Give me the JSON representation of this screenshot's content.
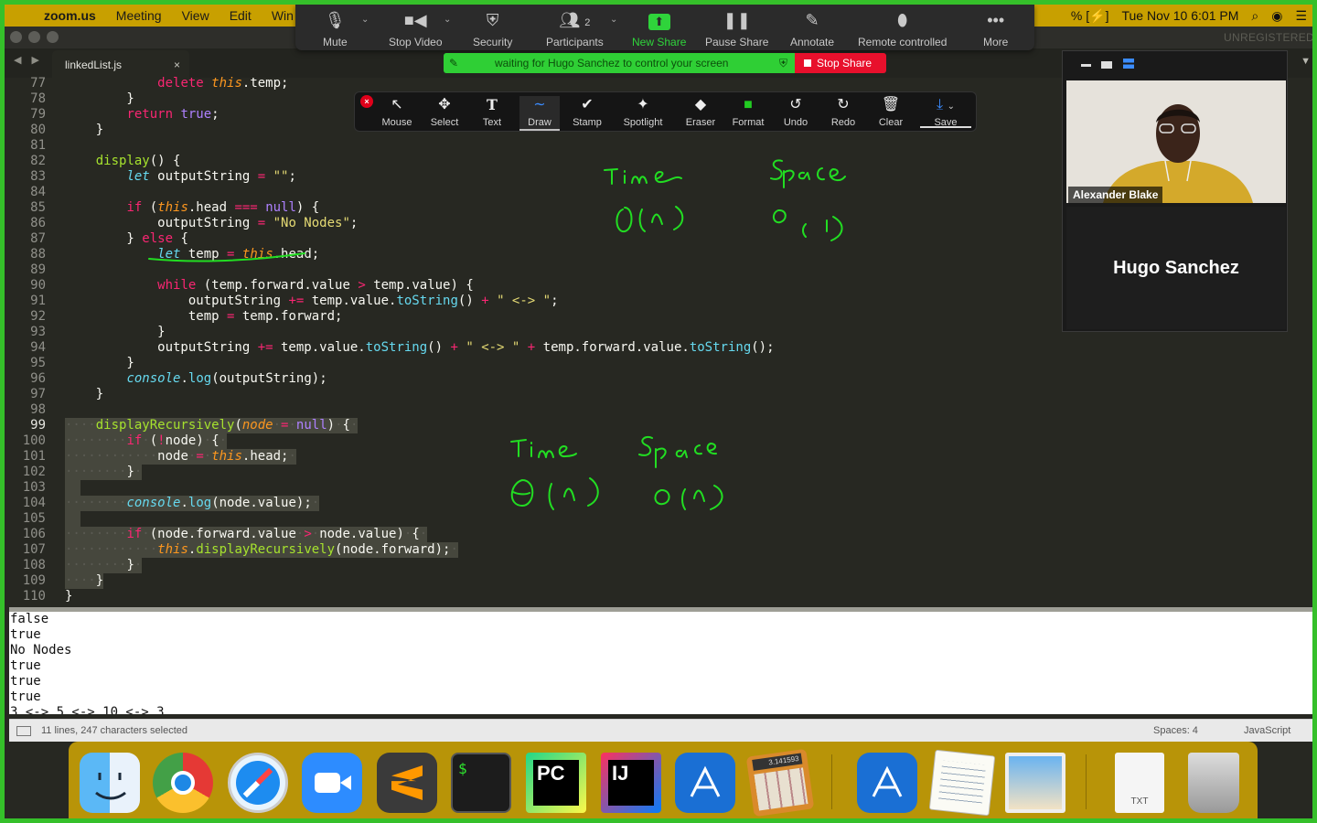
{
  "menubar": {
    "apple": "",
    "app": "zoom.us",
    "items": [
      "Meeting",
      "View",
      "Edit",
      "Win"
    ],
    "right": {
      "battery": "% [⚡]",
      "datetime": "Tue Nov 10  6:01 PM"
    }
  },
  "editor_window": {
    "watermark": "UNREGISTERED",
    "tab_label": "linkedList.js",
    "tab_close": "×",
    "nav_arrows": "◀ ▶",
    "tab_dropdown": "▼"
  },
  "zoom_toolbar": {
    "mute": "Mute",
    "stop_video": "Stop Video",
    "security": "Security",
    "participants": "Participants",
    "participants_count": "2",
    "new_share": "New Share",
    "pause_share": "Pause Share",
    "annotate": "Annotate",
    "remote_controlled": "Remote controlled",
    "more": "More",
    "caret": "⌄"
  },
  "share_notice": {
    "message": "waiting for Hugo Sanchez to control your screen",
    "stop_share": "Stop Share"
  },
  "annotation_toolbar": {
    "close": "×",
    "tools": [
      {
        "label": "Mouse",
        "icon": "↖"
      },
      {
        "label": "Select",
        "icon": "✥"
      },
      {
        "label": "Text",
        "icon": "T"
      },
      {
        "label": "Draw",
        "icon": "∼"
      },
      {
        "label": "Stamp",
        "icon": "✔"
      },
      {
        "label": "Spotlight",
        "icon": "✦"
      },
      {
        "label": "Eraser",
        "icon": "◆"
      },
      {
        "label": "Format",
        "icon": "■"
      },
      {
        "label": "Undo",
        "icon": "↺"
      },
      {
        "label": "Redo",
        "icon": "↻"
      },
      {
        "label": "Clear",
        "icon": "🗑"
      }
    ],
    "save": "Save",
    "save_icon": "⤓",
    "save_caret": "⌄",
    "format_color": "#22cc22"
  },
  "code": {
    "line_numbers": [
      "77",
      "78",
      "79",
      "80",
      "81",
      "82",
      "83",
      "84",
      "85",
      "86",
      "87",
      "88",
      "89",
      "90",
      "91",
      "92",
      "93",
      "94",
      "95",
      "96",
      "97",
      "98",
      "99",
      "100",
      "101",
      "102",
      "103",
      "104",
      "105",
      "106",
      "107",
      "108",
      "109",
      "110"
    ],
    "current_line": "99"
  },
  "drawing_color": "#22dd22",
  "console": {
    "lines": [
      "false",
      "true",
      "No Nodes",
      "true",
      "true",
      "true",
      "3 <-> 5 <-> 10 <-> 3"
    ]
  },
  "status_bar": {
    "selection": "11 lines, 247 characters selected",
    "indent": "Spaces: 4",
    "syntax": "JavaScript"
  },
  "participants": {
    "self_name": "Alexander Blake",
    "remote_name": "Hugo Sanchez"
  },
  "dock": {
    "apps": [
      "Finder",
      "Chrome",
      "Safari",
      "Zoom",
      "Sublime Text",
      "Terminal",
      "PyCharm",
      "IntelliJ IDEA",
      "Xcode",
      "Calculator",
      "Xcode",
      "TextEdit",
      "Preview",
      "TXT",
      "Trash"
    ],
    "terminal_prompt": "$",
    "pycharm_badge": "PC",
    "intellij_badge": "IJ",
    "calculator_display": "3.141593",
    "txt_label": "TXT"
  }
}
